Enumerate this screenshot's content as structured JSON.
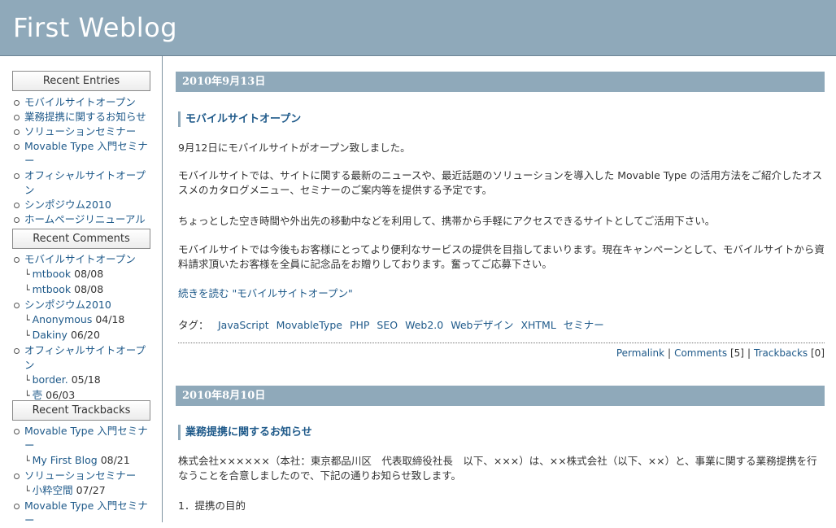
{
  "header": {
    "title": "First Weblog"
  },
  "sidebar": {
    "recent_entries": {
      "title": "Recent Entries",
      "items": [
        "モバイルサイトオープン",
        "業務提携に関するお知らせ",
        "ソリューションセミナー",
        "Movable Type 入門セミナー",
        "オフィシャルサイトオープン",
        "シンポジウム2010",
        "ホームページリニューアル"
      ]
    },
    "recent_comments": {
      "title": "Recent Comments",
      "groups": [
        {
          "entry": "モバイルサイトオープン",
          "comments": [
            {
              "author": "mtbook",
              "date": "08/08"
            },
            {
              "author": "mtbook",
              "date": "08/08"
            }
          ]
        },
        {
          "entry": "シンポジウム2010",
          "comments": [
            {
              "author": "Anonymous",
              "date": "04/18"
            },
            {
              "author": "Dakiny",
              "date": "06/20"
            }
          ]
        },
        {
          "entry": "オフィシャルサイトオープン",
          "comments": [
            {
              "author": "border.",
              "date": "05/18"
            },
            {
              "author": "壱",
              "date": "06/03"
            }
          ]
        }
      ]
    },
    "recent_trackbacks": {
      "title": "Recent Trackbacks",
      "groups": [
        {
          "entry": "Movable Type 入門セミナー",
          "trackbacks": [
            {
              "source": "My First Blog",
              "date": "08/21"
            }
          ]
        },
        {
          "entry": "ソリューションセミナー",
          "trackbacks": [
            {
              "source": "小粋空間",
              "date": "07/27"
            }
          ]
        },
        {
          "entry": "Movable Type 入門セミナー"
        }
      ]
    }
  },
  "entries": [
    {
      "date": "2010年9月13日",
      "title": "モバイルサイトオープン",
      "paragraphs": [
        "9月12日にモバイルサイトがオープン致しました。",
        "モバイルサイトでは、サイトに関する最新のニュースや、最近話題のソリューションを導入した Movable Type の活用方法をご紹介したオススメのカタログメニュー、セミナーのご案内等を提供する予定です。",
        "ちょっとした空き時間や外出先の移動中などを利用して、携帯から手軽にアクセスできるサイトとしてご活用下さい。",
        "モバイルサイトでは今後もお客様にとってより便利なサービスの提供を目指してまいります。現在キャンペーンとして、モバイルサイトから資料請求頂いたお客様を全員に記念品をお贈りしております。奮ってご応募下さい。"
      ],
      "continue_link": "続きを読む \"モバイルサイトオープン\"",
      "tags_label": "タグ：",
      "tags": [
        "JavaScript",
        "MovableType",
        "PHP",
        "SEO",
        "Web2.0",
        "Webデザイン",
        "XHTML",
        "セミナー"
      ],
      "footer": {
        "permalink": "Permalink",
        "comments": "Comments",
        "comments_count": "[5]",
        "trackbacks": "Trackbacks",
        "trackbacks_count": "[0]"
      }
    },
    {
      "date": "2010年8月10日",
      "title": "業務提携に関するお知らせ",
      "paragraphs": [
        "株式会社××××××（本社：東京都品川区　代表取締役社長　以下、×××）は、××株式会社（以下、××）と、事業に関する業務提携を行なうことを合意しましたので、下記の通りお知らせ致します。",
        "1．提携の目的"
      ]
    }
  ]
}
